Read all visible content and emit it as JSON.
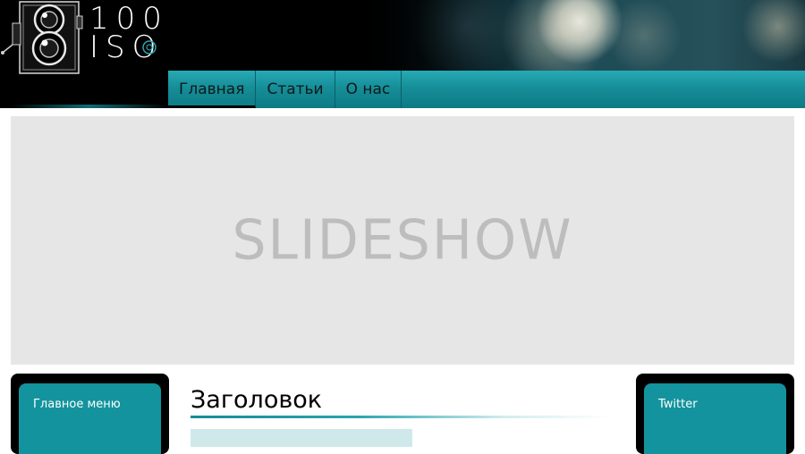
{
  "logo": {
    "line1": "100",
    "line2": "ISO",
    "icon": "camera-icon"
  },
  "nav": [
    {
      "label": "Главная",
      "active": true
    },
    {
      "label": "Статьи",
      "active": false
    },
    {
      "label": "О нас",
      "active": false
    }
  ],
  "slideshow": {
    "label": "SLIDESHOW"
  },
  "left_sidebar": {
    "title": "Главное меню"
  },
  "right_sidebar": {
    "title": "Twitter"
  },
  "main": {
    "heading": "Заголовок"
  },
  "colors": {
    "accent": "#13939d",
    "header_bg": "#000000",
    "slideshow_bg": "#e6e6e6"
  }
}
